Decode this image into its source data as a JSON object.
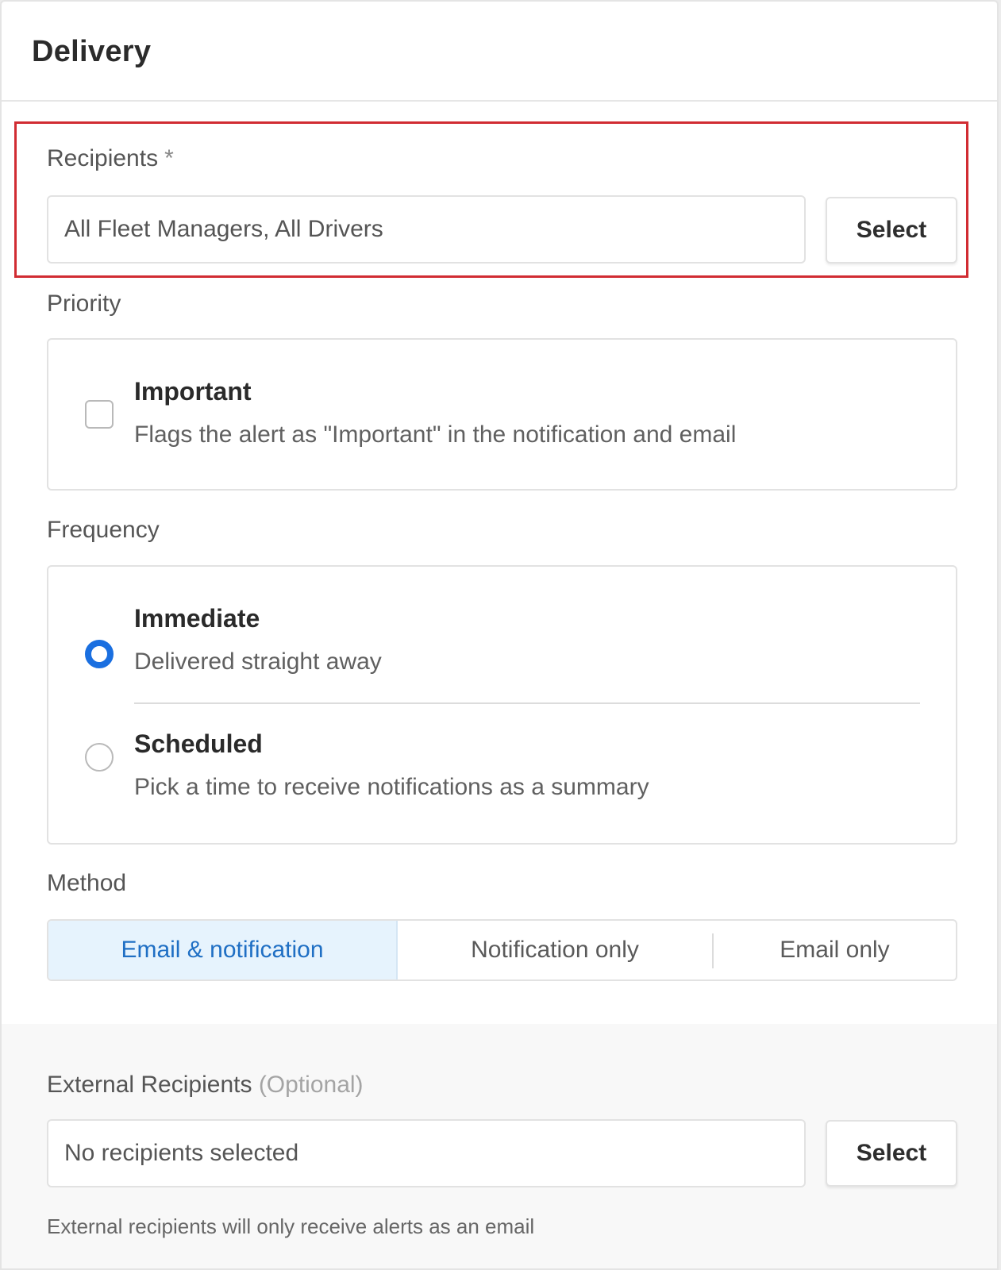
{
  "panel": {
    "title": "Delivery"
  },
  "recipients": {
    "label": "Recipients",
    "required_marker": "*",
    "value": "All Fleet Managers, All Drivers",
    "select_label": "Select"
  },
  "priority": {
    "label": "Priority",
    "option": {
      "title": "Important",
      "description": "Flags the alert as \"Important\" in the notification and email",
      "checked": false
    }
  },
  "frequency": {
    "label": "Frequency",
    "options": [
      {
        "title": "Immediate",
        "description": "Delivered straight away",
        "selected": true
      },
      {
        "title": "Scheduled",
        "description": "Pick a time to receive notifications as a summary",
        "selected": false
      }
    ]
  },
  "method": {
    "label": "Method",
    "options": [
      "Email & notification",
      "Notification only",
      "Email only"
    ],
    "selected": "Email & notification"
  },
  "external_recipients": {
    "label": "External Recipients",
    "optional_tag": "(Optional)",
    "placeholder": "No recipients selected",
    "select_label": "Select",
    "hint": "External recipients will only receive alerts as an email"
  },
  "colors": {
    "accent": "#1a6fe0",
    "highlight_border": "#d12c32",
    "active_segment_bg": "#e6f3fd"
  }
}
